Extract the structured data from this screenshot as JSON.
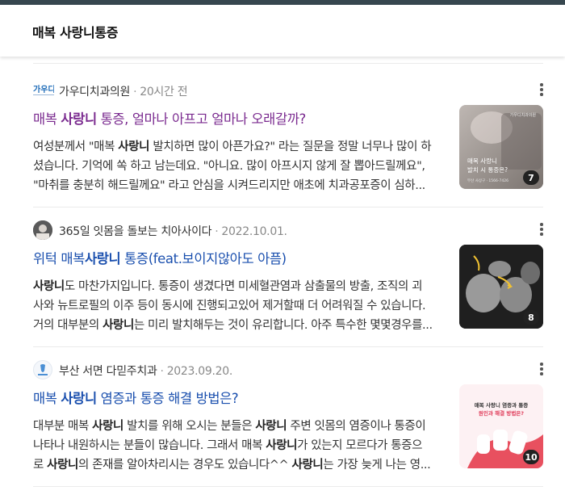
{
  "header": {
    "title": "매복 사랑니통증"
  },
  "results": [
    {
      "source": "가우디치과의원",
      "date": "20시간 전",
      "favicon_text": "가우디",
      "title_parts": [
        {
          "t": "매복 ",
          "b": false
        },
        {
          "t": "사랑니",
          "b": true
        },
        {
          "t": " 통증, 얼마나 아프고 얼마나 오래갈까?",
          "b": false
        }
      ],
      "title_color": "#7a2a8f",
      "lines": [
        [
          {
            "t": "여성분께서 \"매복 ",
            "b": false
          },
          {
            "t": "사랑니",
            "b": true
          },
          {
            "t": " 발치하면 많이 아픈가요?\" 라는 질문을 정말 너무나 많이 하",
            "b": false
          }
        ],
        [
          {
            "t": "셨습니다. 기억에 쏙 하고 남는데요. \"아니요. 많이 아프시지 않게 잘 뽑아드릴께요\",",
            "b": false
          }
        ],
        [
          {
            "t": "\"마취를 충분히 해드릴께요\" 라고 안심을 시켜드리지만 애초에 치과공포증이 심하...",
            "b": false
          }
        ]
      ],
      "thumb": {
        "header": "가우디치과의원",
        "line1": "매복 사랑니",
        "line2": "발치 시 통증은?",
        "foot": "부산 사상구 · 1566-7426",
        "count": "7"
      }
    },
    {
      "source": "365일 잇몸을 돌보는 치아사이다",
      "date": "2022.10.01.",
      "title_parts": [
        {
          "t": "위턱 매복",
          "b": false
        },
        {
          "t": "사랑니",
          "b": true
        },
        {
          "t": " 통증(feat.보이지않아도 아픔)",
          "b": false
        }
      ],
      "title_color": "#1a4fae",
      "lines": [
        [
          {
            "t": "사랑니",
            "b": true
          },
          {
            "t": "도 마찬가지입니다. 통증이 생겼다면 미세혈관염과 삼출물의 방출, 조직의 괴",
            "b": false
          }
        ],
        [
          {
            "t": "사와 뉴트로필의 이주 등이 동시에 진행되고있어 제거할때 더 어려워질 수 있습니다.",
            "b": false
          }
        ],
        [
          {
            "t": "거의 대부분의 ",
            "b": false
          },
          {
            "t": "사랑니",
            "b": true
          },
          {
            "t": "는 미리 발치해두는 것이 유리합니다. 아주 특수한 몇몇경우를...",
            "b": false
          }
        ]
      ],
      "thumb": {
        "count": "8"
      }
    },
    {
      "source": "부산 서면 다믿주치과",
      "date": "2023.09.20.",
      "title_parts": [
        {
          "t": "매복 ",
          "b": false
        },
        {
          "t": "사랑니",
          "b": true
        },
        {
          "t": " 염증과 통증 해결 방법은?",
          "b": false
        }
      ],
      "title_color": "#1a4fae",
      "lines": [
        [
          {
            "t": "대부분 매복 ",
            "b": false
          },
          {
            "t": "사랑니",
            "b": true
          },
          {
            "t": " 발치를 위해 오시는 분들은 ",
            "b": false
          },
          {
            "t": "사랑니",
            "b": true
          },
          {
            "t": " 주변 잇몸의 염증이나 통증이",
            "b": false
          }
        ],
        [
          {
            "t": "나타나 내원하시는 분들이 많습니다. 그래서 매복 ",
            "b": false
          },
          {
            "t": "사랑니",
            "b": true
          },
          {
            "t": "가 있는지 모르다가 통증으",
            "b": false
          }
        ],
        [
          {
            "t": "로 ",
            "b": false
          },
          {
            "t": "사랑니",
            "b": true
          },
          {
            "t": "의 존재를 알아차리시는 경우도 있습니다^^ ",
            "b": false
          },
          {
            "t": "사랑니",
            "b": true
          },
          {
            "t": "는 가장 늦게 나는 영...",
            "b": false
          }
        ]
      ],
      "thumb": {
        "line1": "매복 사랑니 염증과 통증",
        "line2": "원인과 해결 방법은?",
        "count": "10"
      }
    }
  ],
  "colors": {
    "title_visited": "#7a2a8f",
    "title_link": "#1a4fae",
    "topbar": "#37474f"
  },
  "icons": [
    "more-vert-icon"
  ]
}
